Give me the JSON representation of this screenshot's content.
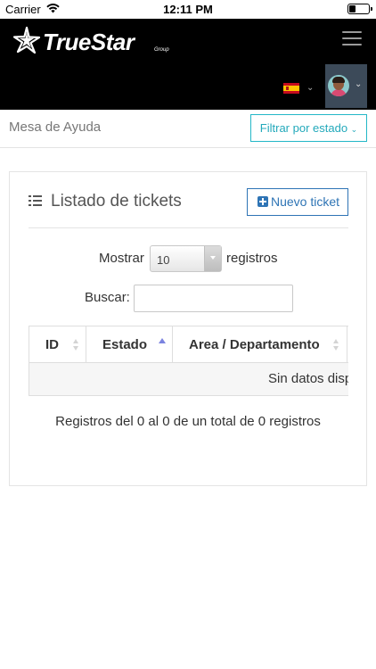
{
  "status_bar": {
    "carrier": "Carrier",
    "time": "12:11 PM",
    "battery_percent": 35
  },
  "navbar": {
    "logo_text": "TrueStar",
    "logo_subtext": "Group",
    "menu_icon": "hamburger-icon",
    "language_flag": "spain-flag",
    "user_avatar": "avatar"
  },
  "subheader": {
    "breadcrumb": "Mesa de Ayuda",
    "filter_button": "Filtrar por estado"
  },
  "panel": {
    "title": "Listado de tickets",
    "title_icon": "list-icon",
    "new_ticket_button": "Nuevo ticket",
    "show_label": "Mostrar",
    "page_size": "10",
    "records_label": "registros",
    "search_label": "Buscar:",
    "search_value": "",
    "table": {
      "columns": [
        "ID",
        "Estado",
        "Area / Departamento"
      ],
      "sorted_column": "Estado",
      "sort_direction": "asc",
      "empty_text": "Sin datos disp"
    },
    "info_text": "Registros del 0 al 0 de un total de 0 registros"
  },
  "colors": {
    "navbar_bg": "#000000",
    "filter_accent": "#23b7c7",
    "primary": "#2e74b5",
    "sort_active": "#7b83e0"
  }
}
